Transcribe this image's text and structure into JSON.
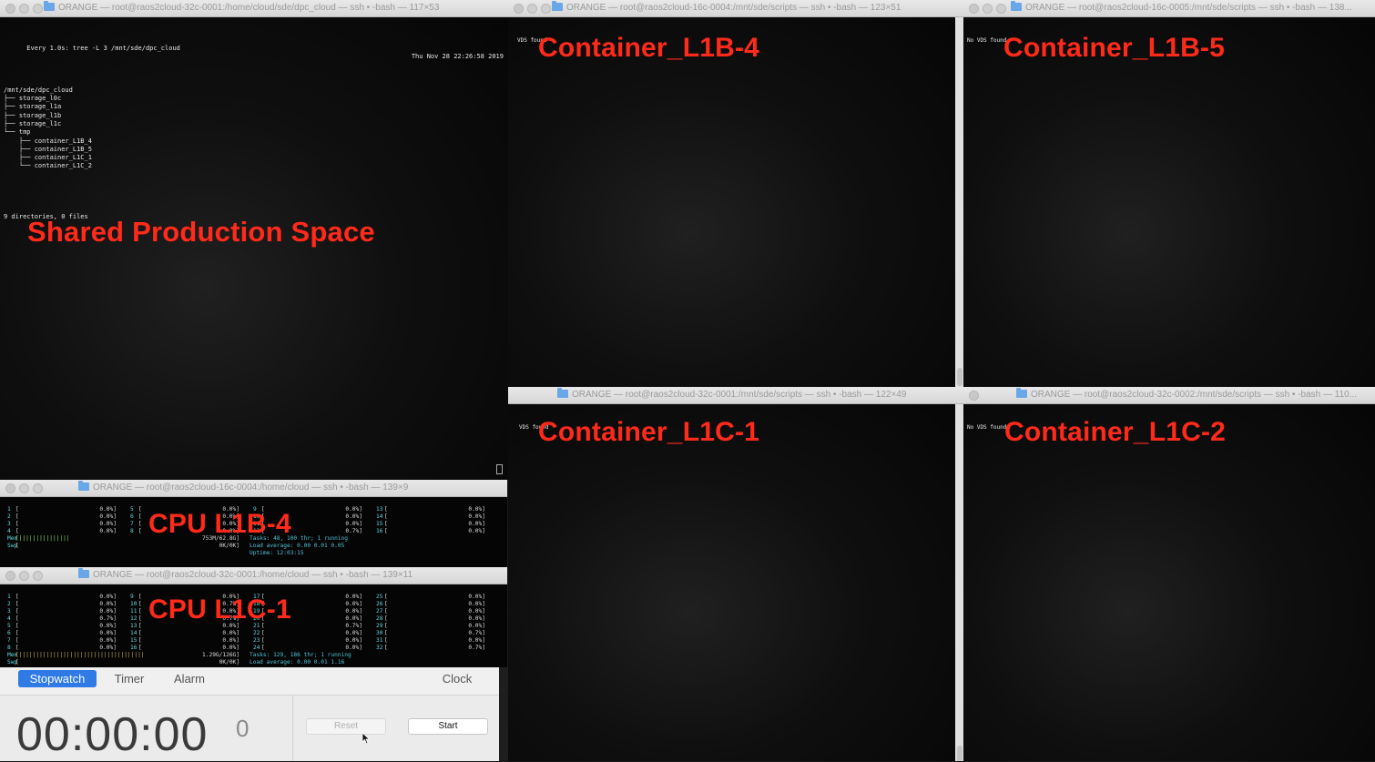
{
  "windows": {
    "top_left": {
      "title": "ORANGE — root@raos2cloud-32c-0001:/home/cloud/sde/dpc_cloud — ssh • -bash — 117×53",
      "header_cmd": "Every 1.0s: tree -L 3 /mnt/sde/dpc_cloud",
      "header_time": "Thu Nov 28 22:26:58 2019",
      "tree_lines": [
        "/mnt/sde/dpc_cloud",
        "├── storage_l0c",
        "├── storage_l1a",
        "├── storage_l1b",
        "├── storage_l1c",
        "└── tmp",
        "    ├── container_L1B_4",
        "    ├── container_L1B_5",
        "    ├── container_L1C_1",
        "    └── container_L1C_2"
      ],
      "summary": "9 directories, 0 files",
      "overlay": "Shared Production Space"
    },
    "top_middle": {
      "title": "ORANGE — root@raos2cloud-16c-0004:/mnt/sde/scripts — ssh • -bash — 123×51",
      "line": "VDS found",
      "overlay": "Container_L1B-4"
    },
    "top_right": {
      "title": "ORANGE — root@raos2cloud-16c-0005:/mnt/sde/scripts — ssh • -bash — 138...",
      "line": "No VDS found",
      "overlay": "Container_L1B-5"
    },
    "bottom_middle": {
      "title": "ORANGE — root@raos2cloud-32c-0001:/mnt/sde/scripts — ssh • -bash — 122×49",
      "line": "VDS found",
      "overlay": "Container_L1C-1"
    },
    "bottom_right": {
      "title": "ORANGE — root@raos2cloud-32c-0002:/mnt/sde/scripts — ssh • -bash — 110...",
      "line": "No VDS found",
      "overlay": "Container_L1C-2"
    },
    "htop_1": {
      "title": "ORANGE — root@raos2cloud-16c-0004:/home/cloud — ssh • -bash — 139×9",
      "overlay": "CPU L1B-4",
      "cols": [
        [
          [
            "1",
            "0.0%]"
          ],
          [
            "2",
            "0.0%]"
          ],
          [
            "3",
            "0.0%]"
          ],
          [
            "4",
            "0.0%]"
          ]
        ],
        [
          [
            "5",
            "0.0%]"
          ],
          [
            "6",
            "0.0%]"
          ],
          [
            "7",
            "0.0%]"
          ],
          [
            "8",
            "0.0%]"
          ]
        ],
        [
          [
            "9",
            "0.0%]"
          ],
          [
            "10",
            "0.0%]"
          ],
          [
            "11",
            "0.0%]"
          ],
          [
            "12",
            "0.7%]"
          ]
        ],
        [
          [
            "13",
            "0.0%]"
          ],
          [
            "14",
            "0.0%]"
          ],
          [
            "15",
            "0.0%]"
          ],
          [
            "16",
            "0.0%]"
          ]
        ]
      ],
      "mem": "753M/62.8G]",
      "swp": "0K/0K]",
      "tasks": "Tasks: 48, 100 thr; 1 running",
      "load": "Load average: 0.00 0.01 0.05",
      "uptime": "Uptime: 12:03:15"
    },
    "htop_2": {
      "title": "ORANGE — root@raos2cloud-32c-0001:/home/cloud — ssh • -bash — 139×11",
      "overlay": "CPU L1C-1",
      "cols": [
        [
          [
            "1",
            "0.0%]"
          ],
          [
            "2",
            "0.0%]"
          ],
          [
            "3",
            "0.0%]"
          ],
          [
            "4",
            "0.7%]"
          ],
          [
            "5",
            "0.0%]"
          ],
          [
            "6",
            "0.0%]"
          ],
          [
            "7",
            "0.0%]"
          ],
          [
            "8",
            "0.0%]"
          ]
        ],
        [
          [
            "9",
            "0.0%]"
          ],
          [
            "10",
            "0.7%]"
          ],
          [
            "11",
            "0.0%]"
          ],
          [
            "12",
            "0.7%]"
          ],
          [
            "13",
            "0.0%]"
          ],
          [
            "14",
            "0.0%]"
          ],
          [
            "15",
            "0.0%]"
          ],
          [
            "16",
            "0.0%]"
          ]
        ],
        [
          [
            "17",
            "0.0%]"
          ],
          [
            "18",
            "0.0%]"
          ],
          [
            "19",
            "0.0%]"
          ],
          [
            "20",
            "0.0%]"
          ],
          [
            "21",
            "0.7%]"
          ],
          [
            "22",
            "0.0%]"
          ],
          [
            "23",
            "0.0%]"
          ],
          [
            "24",
            "0.0%]"
          ]
        ],
        [
          [
            "25",
            "0.0%]"
          ],
          [
            "26",
            "0.0%]"
          ],
          [
            "27",
            "0.0%]"
          ],
          [
            "28",
            "0.0%]"
          ],
          [
            "29",
            "0.0%]"
          ],
          [
            "30",
            "0.7%]"
          ],
          [
            "31",
            "0.0%]"
          ],
          [
            "32",
            "0.7%]"
          ]
        ]
      ],
      "mem": "1.29G/126G]",
      "swp": "0K/0K]",
      "tasks": "Tasks: 129, 186 thr; 1 running",
      "load": "Load average: 0.00 0.01 1.16"
    }
  },
  "clock": {
    "tabs": [
      "Stopwatch",
      "Timer",
      "Alarm"
    ],
    "right_title": "Clock",
    "time": "00:00:00",
    "fraction": "0",
    "reset_label": "Reset",
    "start_label": "Start"
  },
  "colors": {
    "overlay_red": "#ff2a1a",
    "accent_blue": "#2f7ae5",
    "htop_cyan": "#5fd7e0"
  }
}
